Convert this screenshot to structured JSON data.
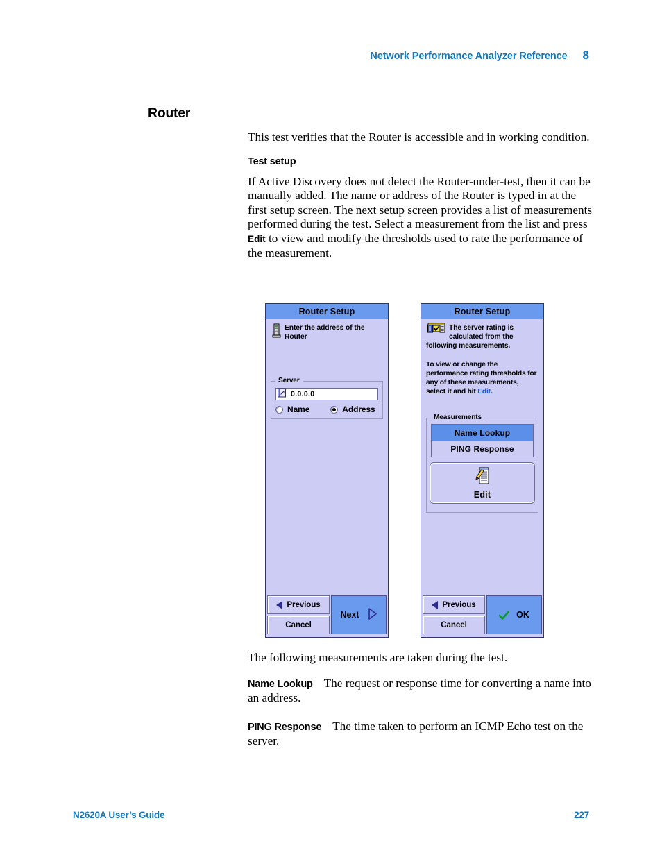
{
  "header": {
    "title": "Network Performance Analyzer Reference",
    "chapter": "8"
  },
  "section": {
    "title": "Router",
    "intro": "This test verifies that the Router is accessible and in working condition.",
    "subhead": "Test setup",
    "setup_text_1": "If Active Discovery does not detect the Router-under-test, then it can be manually added. The name or address of the Router is typed in at the first setup screen. The next setup screen provides a list of measurements performed during the test. Select a measurement from the list and press ",
    "setup_bold": "Edit",
    "setup_text_2": " to view and modify the thresholds used to rate the performance of the measurement.",
    "after_figure": "The following measurements are taken during the test.",
    "definitions": [
      {
        "term": "Name Lookup",
        "text": "The request or response time for converting a name into an address."
      },
      {
        "term": "PING Response",
        "text": "The time taken to perform an ICMP Echo test on the server."
      }
    ]
  },
  "figure": {
    "dialog_left": {
      "title": "Router Setup",
      "icon": "router-device-icon",
      "instruction": "Enter the address of the Router",
      "group_legend": "Server",
      "address_icon": "address-book-icon",
      "address_value": "0.0.0.0",
      "radio_name_label": "Name",
      "radio_address_label": "Address",
      "radio_selected": "Address",
      "buttons": {
        "previous": "Previous",
        "cancel": "Cancel",
        "primary": "Next"
      }
    },
    "dialog_right": {
      "title": "Router Setup",
      "icon": "rating-scale-check-icon",
      "instruction_1": "The server rating is calculated from the following measurements.",
      "instruction_2_a": "To view or change the performance rating thresholds for any of these measurements, select it and hit ",
      "instruction_2_link": "Edit",
      "instruction_2_b": ".",
      "group_legend": "Measurements",
      "measurements": [
        {
          "label": "Name Lookup",
          "selected": true
        },
        {
          "label": "PING Response",
          "selected": false
        }
      ],
      "edit_button": {
        "icon": "edit-list-pencil-icon",
        "label": "Edit"
      },
      "buttons": {
        "previous": "Previous",
        "cancel": "Cancel",
        "primary": "OK"
      }
    }
  },
  "footer": {
    "left": "N2620A User’s Guide",
    "right": "227"
  },
  "colors": {
    "accent_blue": "#1277bc",
    "dialog_titlebar": "#6a9aee",
    "dialog_body": "#ccccf5",
    "selection": "#5b8fe8",
    "link": "#1a56d6"
  }
}
